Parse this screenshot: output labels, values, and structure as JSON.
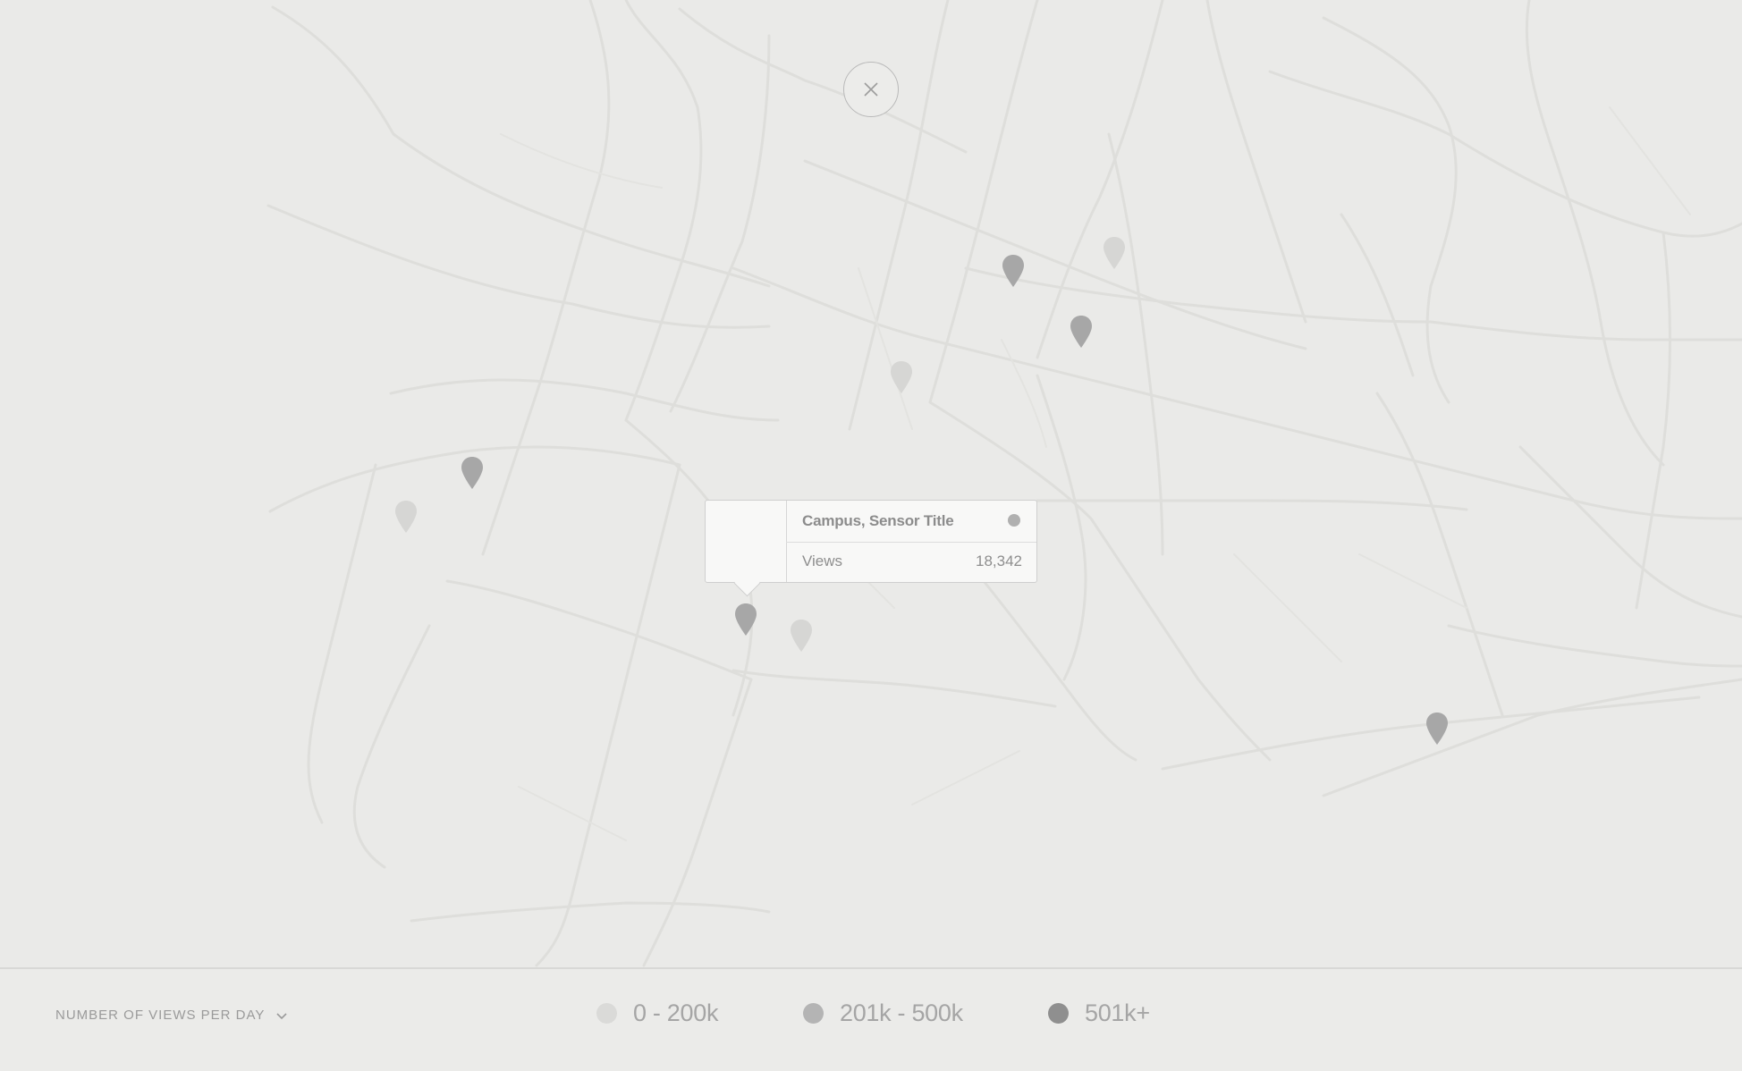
{
  "popup": {
    "title": "Campus, Sensor Title",
    "metric_label": "Views",
    "metric_value": "18,342",
    "status_color": "#b0b0b0"
  },
  "footer": {
    "filter_label": "NUMBER OF VIEWS PER DAY",
    "legend": [
      {
        "label": "0 - 200k",
        "color": "#dadad8"
      },
      {
        "label": "201k - 500k",
        "color": "#b4b4b4"
      },
      {
        "label": "501k+",
        "color": "#8f8f8f"
      }
    ]
  },
  "markers": [
    {
      "tier": "201k - 500k",
      "color": "#a7a7a7"
    },
    {
      "tier": "0 - 200k",
      "color": "#d6d6d4"
    },
    {
      "tier": "201k - 500k",
      "color": "#a7a7a7"
    },
    {
      "tier": "0 - 200k",
      "color": "#d6d6d4"
    },
    {
      "tier": "201k - 500k",
      "color": "#a7a7a7"
    },
    {
      "tier": "0 - 200k",
      "color": "#d6d6d4"
    },
    {
      "tier": "201k - 500k",
      "color": "#a7a7a7"
    },
    {
      "tier": "0 - 200k",
      "color": "#d6d6d4"
    },
    {
      "tier": "201k - 500k",
      "color": "#a7a7a7"
    }
  ],
  "icons": {
    "close": "close-icon",
    "dropdown": "chevron-down-icon",
    "marker": "map-pin-icon"
  }
}
